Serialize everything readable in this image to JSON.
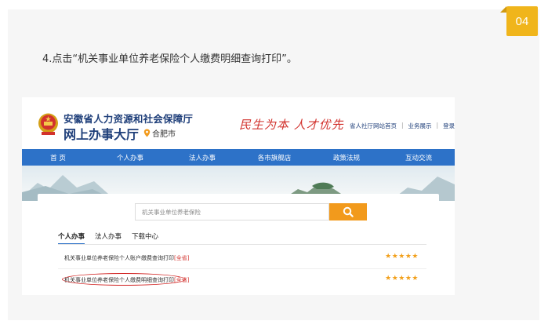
{
  "step": {
    "number": "04",
    "instruction": "4.点击“机关事业单位养老保险个人缴费明细查询打印”。"
  },
  "site": {
    "org_name": "安徽省人力资源和社会保障厅",
    "hall_name": "网上办事大厅",
    "location": "合肥市",
    "slogan": "民生为本 人才优先",
    "top_links": [
      "省人社厅网站首页",
      "业务展示",
      "登录"
    ],
    "top_link_separator": "|",
    "nav": [
      "首 页",
      "个人办事",
      "法人办事",
      "各市旗舰店",
      "政策法规",
      "互动交流"
    ]
  },
  "search": {
    "value": "机关事业单位养老保险"
  },
  "tabs": [
    {
      "label": "个人办事",
      "active": true
    },
    {
      "label": "法人办事",
      "active": false
    },
    {
      "label": "下载中心",
      "active": false
    }
  ],
  "results": [
    {
      "title": "机关事业单位养老保险个人账户缴费查询打印",
      "tag": "[全省]",
      "rating": 4.5,
      "stars": "★★★★★"
    },
    {
      "title": "机关事业单位养老保险个人缴费明细查询打印",
      "tag": "[全省]",
      "rating": 4.5,
      "stars": "★★★★★"
    }
  ],
  "colors": {
    "badge": "#f0b51b",
    "nav": "#2d72c8",
    "title": "#1f3f7a",
    "slogan": "#d2322d",
    "search_button": "#f29a1c",
    "highlight_oval": "#d0201f",
    "stars": "#f2a01b"
  },
  "icons": {
    "emblem": "national-emblem-icon",
    "location": "location-pin-icon",
    "search": "search-icon",
    "star": "star-icon"
  }
}
